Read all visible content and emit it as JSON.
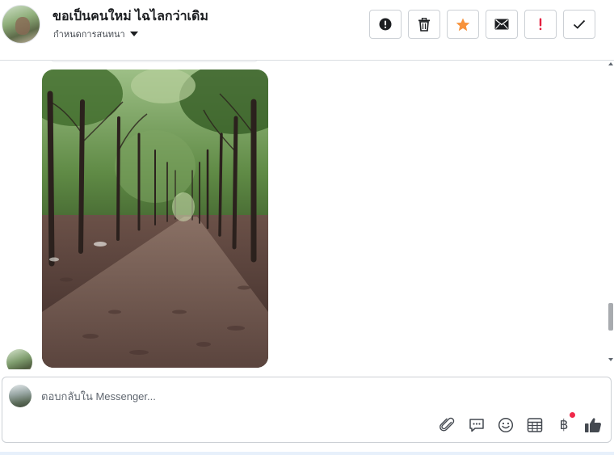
{
  "header": {
    "contact_name": "ขอเป็นคนใหม่ ไฉไลกว่าเดิม",
    "assign_label": "กำหนดการสนทนา",
    "actions": [
      {
        "name": "spam-button",
        "icon": "exclamation-circle-icon",
        "color": "#1c1e21"
      },
      {
        "name": "delete-button",
        "icon": "trash-icon",
        "color": "#1c1e21"
      },
      {
        "name": "star-button",
        "icon": "star-icon",
        "color": "#f7923b"
      },
      {
        "name": "mark-unread-button",
        "icon": "envelope-icon",
        "color": "#1c1e21"
      },
      {
        "name": "follow-up-button",
        "icon": "exclamation-icon",
        "color": "#e41e3f"
      },
      {
        "name": "done-button",
        "icon": "check-icon",
        "color": "#1c1e21"
      }
    ]
  },
  "thread": {
    "attachment": {
      "type": "photo",
      "subject": "rubber-plantation-path"
    }
  },
  "composer": {
    "placeholder": "ตอบกลับใน Messenger...",
    "value": "",
    "tools": [
      {
        "name": "attach-file-button",
        "icon": "paperclip-icon"
      },
      {
        "name": "saved-replies-button",
        "icon": "speech-bubble-icon"
      },
      {
        "name": "emoji-button",
        "icon": "smiley-icon"
      },
      {
        "name": "appointment-button",
        "icon": "calendar-table-icon"
      },
      {
        "name": "payment-button",
        "icon": "baht-icon",
        "symbol": "฿",
        "has_notification": true
      },
      {
        "name": "like-button",
        "icon": "thumbs-up-icon"
      }
    ]
  },
  "colors": {
    "accent_star": "#f7923b",
    "alert_red": "#e41e3f",
    "notification_dot": "#f02849",
    "border": "#ccd0d5"
  }
}
